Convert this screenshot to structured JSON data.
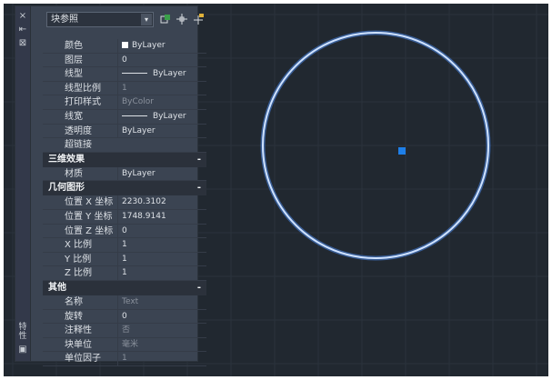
{
  "palette_strip": {
    "close_glyph": "×",
    "autohide_glyph": "⇤",
    "menu_glyph": "⊠",
    "title": "特性"
  },
  "toolbar": {
    "object_type": "块参照",
    "dropdown_glyph": "▾",
    "icons": [
      "quick-select-icon",
      "select-objects-icon",
      "toggle-pickadd-icon"
    ]
  },
  "properties": {
    "general": [
      {
        "label": "颜色",
        "value": "ByLayer",
        "kind": "color"
      },
      {
        "label": "图层",
        "value": "0"
      },
      {
        "label": "线型",
        "value": "ByLayer",
        "kind": "line"
      },
      {
        "label": "线型比例",
        "value": "1",
        "dim": true
      },
      {
        "label": "打印样式",
        "value": "ByColor",
        "dim": true
      },
      {
        "label": "线宽",
        "value": "ByLayer",
        "kind": "line"
      },
      {
        "label": "透明度",
        "value": "ByLayer"
      },
      {
        "label": "超链接",
        "value": ""
      }
    ],
    "sections": [
      {
        "title": "三维效果",
        "collapse": "-",
        "rows": [
          {
            "label": "材质",
            "value": "ByLayer"
          }
        ]
      },
      {
        "title": "几何图形",
        "collapse": "-",
        "rows": [
          {
            "label": "位置 X 坐标",
            "value": "2230.3102"
          },
          {
            "label": "位置 Y 坐标",
            "value": "1748.9141"
          },
          {
            "label": "位置 Z 坐标",
            "value": "0"
          },
          {
            "label": "X 比例",
            "value": "1"
          },
          {
            "label": "Y 比例",
            "value": "1"
          },
          {
            "label": "Z 比例",
            "value": "1"
          }
        ]
      },
      {
        "title": "其他",
        "collapse": "-",
        "rows": [
          {
            "label": "名称",
            "value": "Text",
            "dim": true
          },
          {
            "label": "旋转",
            "value": "0"
          },
          {
            "label": "注释性",
            "value": "否",
            "dim": true
          },
          {
            "label": "块单位",
            "value": "毫米",
            "dim": true
          },
          {
            "label": "单位因子",
            "value": "1",
            "dim": true
          }
        ]
      }
    ]
  },
  "colors": {
    "canvas_bg": "#212830",
    "grid_line": "#2a323c",
    "circle_stroke": "#cfe2ff",
    "circle_glow": "#4a86e8",
    "grip": "#1e7fe8"
  }
}
